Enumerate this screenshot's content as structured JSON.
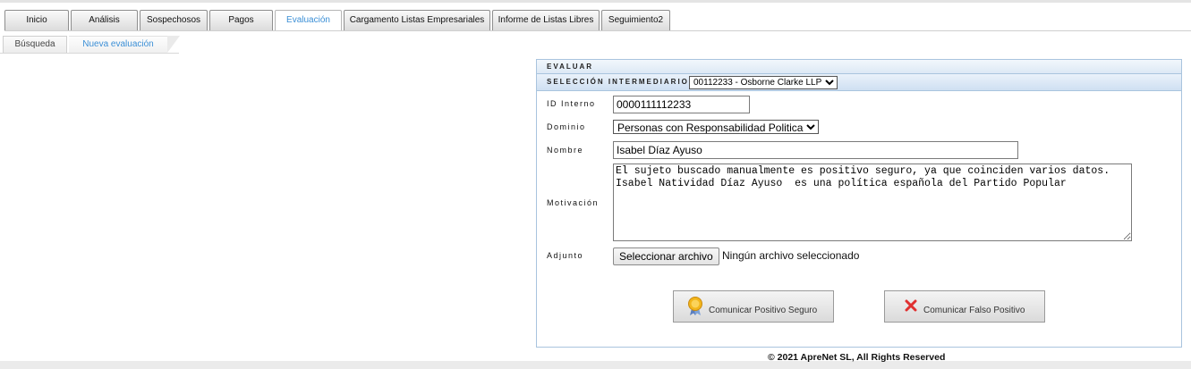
{
  "tabs": [
    {
      "label": "Inicio"
    },
    {
      "label": "Análisis"
    },
    {
      "label": "Sospechosos"
    },
    {
      "label": "Pagos"
    },
    {
      "label": "Evaluación",
      "active": true
    },
    {
      "label": "Cargamento Listas Empresariales"
    },
    {
      "label": "Informe de Listas Libres"
    },
    {
      "label": "Seguimiento2"
    }
  ],
  "subtabs": [
    {
      "label": "Búsqueda"
    },
    {
      "label": "Nueva evaluación",
      "active": true
    }
  ],
  "panel": {
    "title": "EVALUAR",
    "intermediary_label": "SELECCIÓN INTERMEDIARIO",
    "intermediary_value": "00112233 - Osborne Clarke LLP"
  },
  "form": {
    "id_label": "ID Interno",
    "id_value": "0000111112233",
    "domain_label": "Dominio",
    "domain_value": "Personas con Responsabilidad Politica",
    "name_label": "Nombre",
    "name_value": "Isabel Díaz Ayuso",
    "motivation_label": "Motivación",
    "motivation_value": "El sujeto buscado manualmente es positivo seguro, ya que coinciden varios datos.\nIsabel Natividad Díaz Ayuso  es una política española del Partido Popular",
    "attachment_label": "Adjunto",
    "file_button": "Seleccionar archivo",
    "file_status": "Ningún archivo seleccionado"
  },
  "actions": {
    "positive_label": "Comunicar Positivo Seguro",
    "false_label": "Comunicar Falso Positivo",
    "positive_icon": "award-badge-icon",
    "false_icon": "red-x-icon",
    "false_icon_color": "#e03030"
  },
  "footer": {
    "copyright": "© 2021 ApreNet SL,   All Rights Reserved"
  }
}
